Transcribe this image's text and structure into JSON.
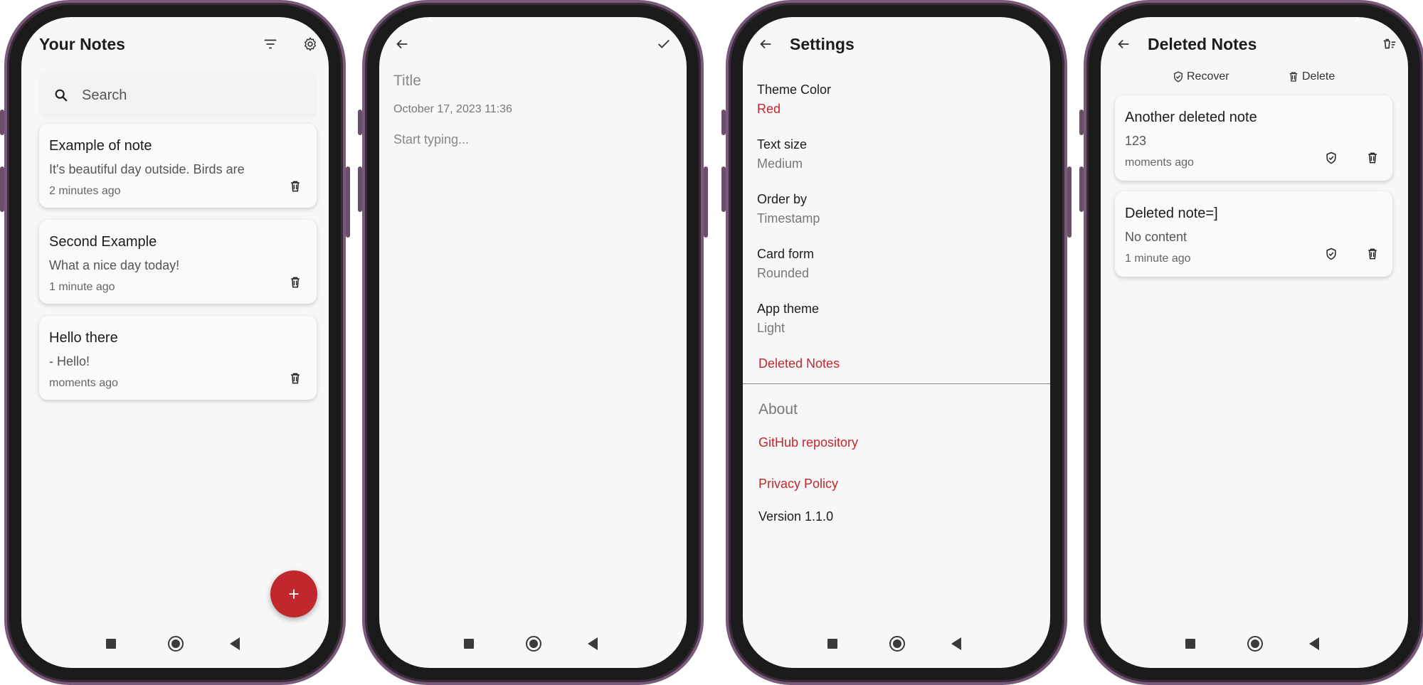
{
  "colors": {
    "accent": "#c0282e",
    "frame": "#7a5a7a",
    "background": "#f7f7f7"
  },
  "notes_screen": {
    "title": "Your Notes",
    "sort_icon": "sort-icon",
    "settings_icon": "gear-icon",
    "search_placeholder": "Search",
    "notes": [
      {
        "title": "Example of note",
        "body": "It's beautiful day outside. Birds are",
        "time": "2 minutes ago"
      },
      {
        "title": "Second Example",
        "body": "What a nice day today!",
        "time": "1 minute ago"
      },
      {
        "title": "Hello there",
        "body": "- Hello!",
        "time": "moments ago"
      }
    ],
    "fab_label": "+"
  },
  "editor_screen": {
    "title_placeholder": "Title",
    "date": "October 17, 2023 11:36",
    "body_placeholder": "Start typing..."
  },
  "settings_screen": {
    "title": "Settings",
    "items": [
      {
        "label": "Theme Color",
        "value": "Red"
      },
      {
        "label": "Text size",
        "value": "Medium"
      },
      {
        "label": "Order by",
        "value": "Timestamp"
      },
      {
        "label": "Card form",
        "value": "Rounded"
      },
      {
        "label": "App theme",
        "value": "Light"
      }
    ],
    "deleted_notes_link": "Deleted Notes",
    "about_heading": "About",
    "github_link": "GitHub repository",
    "privacy_link": "Privacy Policy",
    "version": "Version 1.1.0"
  },
  "deleted_screen": {
    "title": "Deleted Notes",
    "recover_label": "Recover",
    "delete_label": "Delete",
    "notes": [
      {
        "title": "Another deleted note",
        "body": "123",
        "time": "moments ago"
      },
      {
        "title": "Deleted note=]",
        "body": "No content",
        "time": "1 minute ago"
      }
    ]
  }
}
